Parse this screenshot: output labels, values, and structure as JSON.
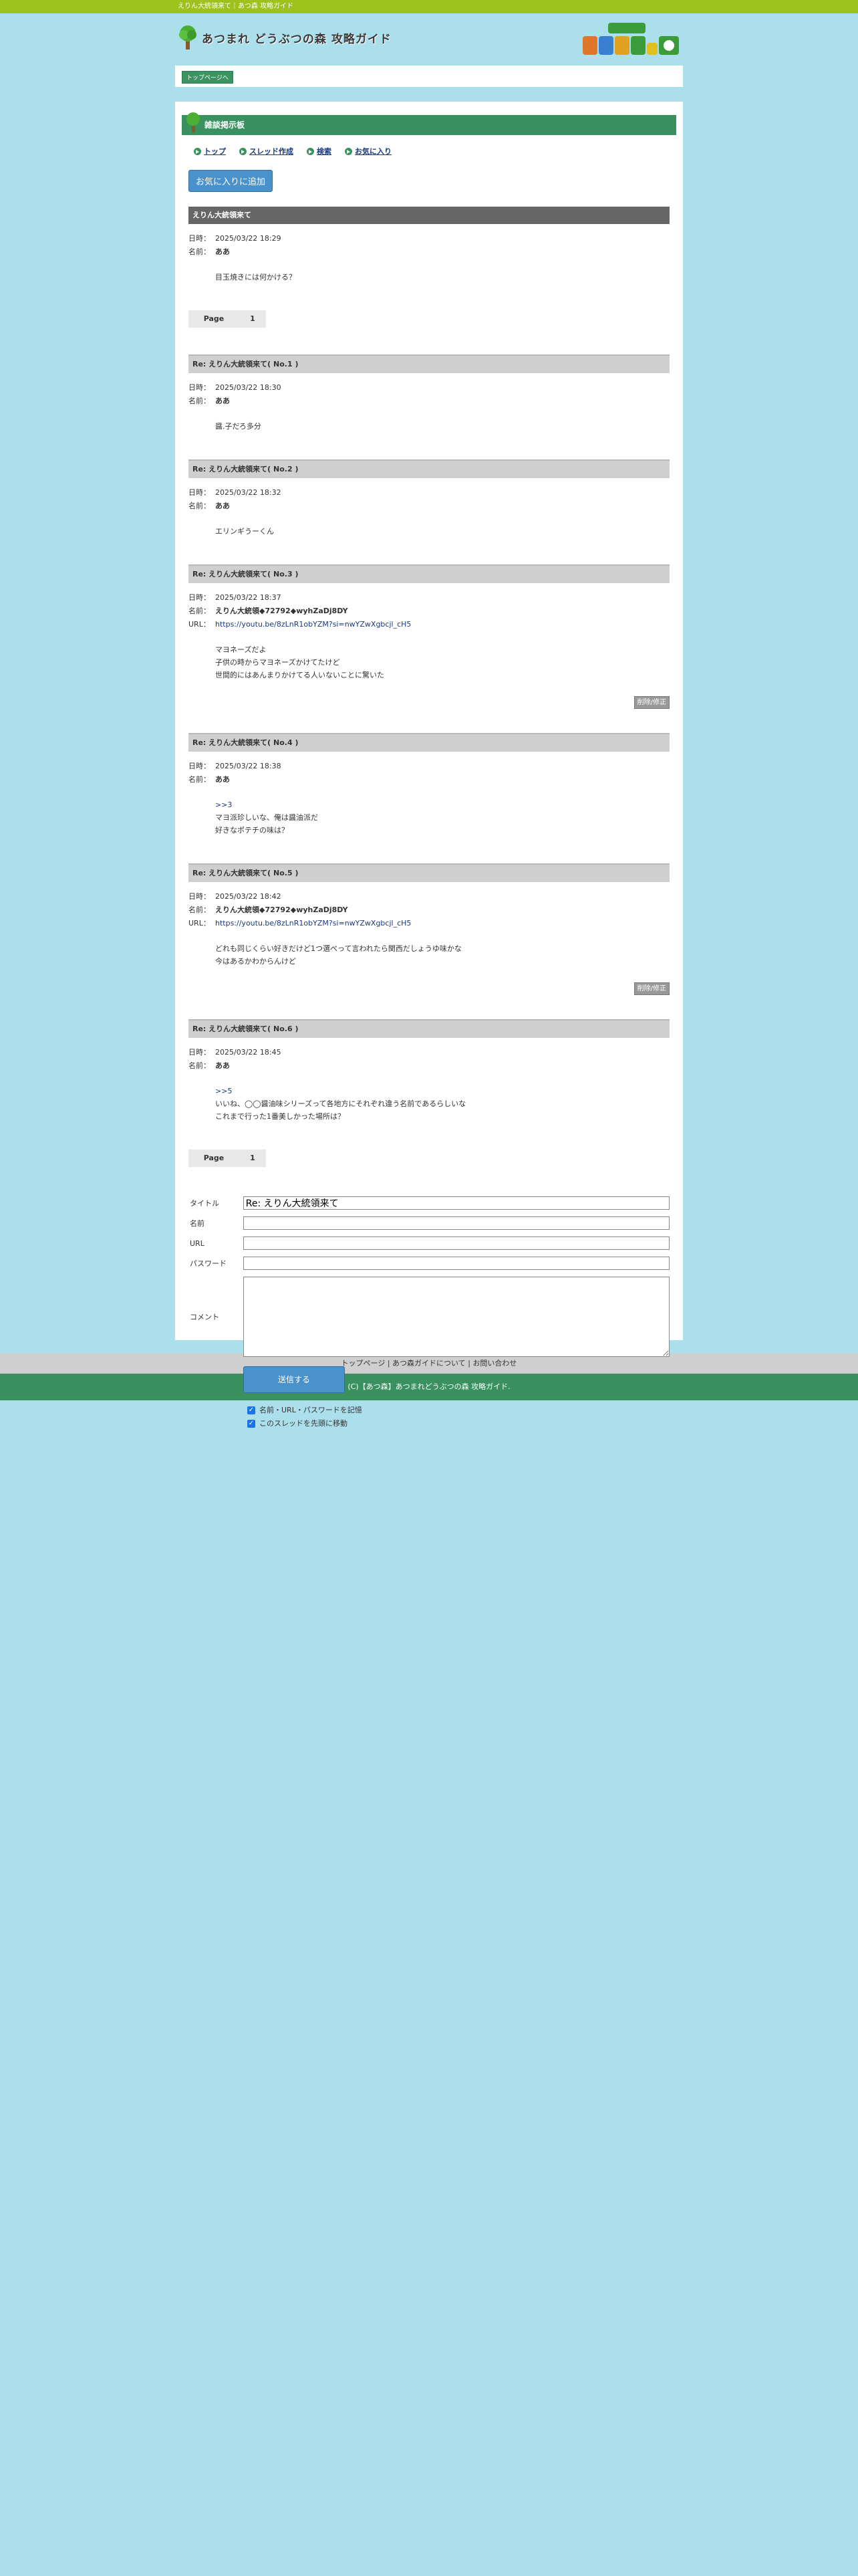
{
  "topbar": {
    "text": "えりん大統領来て｜あつ森 攻略ガイド"
  },
  "header": {
    "title": "あつまれ どうぶつの森 攻略ガイド"
  },
  "breadcrumb": {
    "label": "トップページへ"
  },
  "board": {
    "title": "雑談掲示板"
  },
  "nav": {
    "top": "トップ",
    "new_thread": "スレッド作成",
    "search": "検索",
    "favorites": "お気に入り"
  },
  "fav_button": "お気に入りに追加",
  "thread": {
    "title": "えりん大統領来て",
    "date_label": "日時：",
    "name_label": "名前：",
    "url_label": "URL：",
    "date": "2025/03/22 18:29",
    "name": "ああ",
    "body": "目玉焼きには何かける？"
  },
  "pager_top": {
    "label": "Page",
    "page": "1"
  },
  "posts": [
    {
      "head": "Re: えりん大統領来て( No.1 )",
      "date": "2025/03/22 18:30",
      "name": "ああ",
      "lines": [
        "醤.子だろ多分"
      ]
    },
    {
      "head": "Re: えりん大統領来て( No.2 )",
      "date": "2025/03/22 18:32",
      "name": "ああ",
      "lines": [
        "エリンギうーくん"
      ]
    },
    {
      "head": "Re: えりん大統領来て( No.3 )",
      "date": "2025/03/22 18:37",
      "name": "えりん大統領◆72792◆wyhZaDj8DY",
      "url": "https://youtu.be/8zLnR1obYZM?si=nwYZwXgbcjl_cH5",
      "lines": [
        "マヨネーズだよ",
        "子供の時からマヨネーズかけてたけど",
        "世間的にはあんまりかけてる人いないことに驚いた"
      ],
      "edit": "削除/修正"
    },
    {
      "head": "Re: えりん大統領来て( No.4 )",
      "date": "2025/03/22 18:38",
      "name": "ああ",
      "anchor": ">>3",
      "lines": [
        "マヨ派珍しいな、俺は醤油派だ",
        "好きなポテチの味は？"
      ]
    },
    {
      "head": "Re: えりん大統領来て( No.5 )",
      "date": "2025/03/22 18:42",
      "name": "えりん大統領◆72792◆wyhZaDj8DY",
      "url": "https://youtu.be/8zLnR1obYZM?si=nwYZwXgbcjl_cH5",
      "lines": [
        "どれも同じくらい好きだけど1つ選べって言われたら関西だしょうゆ味かな",
        "今はあるかわからんけど"
      ],
      "edit": "削除/修正"
    },
    {
      "head": "Re: えりん大統領来て( No.6 )",
      "date": "2025/03/22 18:45",
      "name": "ああ",
      "anchor": ">>5",
      "lines": [
        "いいね、◯◯醤油味シリーズって各地方にそれぞれ違う名前であるらしいな",
        "これまで行った1番美しかった場所は？"
      ]
    }
  ],
  "pager_bottom": {
    "label": "Page",
    "page": "1"
  },
  "form": {
    "title_label": "タイトル",
    "title_value": "Re: えりん大統領来て",
    "name_label": "名前",
    "url_label": "URL",
    "password_label": "パスワード",
    "comment_label": "コメント",
    "submit": "送信する",
    "check1": "名前・URL・パスワードを記憶",
    "check2": "このスレッドを先頭に移動"
  },
  "footer": {
    "link1": "トップページ",
    "link2": "あつ森ガイドについて",
    "link3": "お問い合わせ",
    "sep": "|",
    "copyright": "(C)【あつ森】あつまれどうぶつの森 攻略ガイド."
  },
  "colors": {
    "accent_green": "#3a9160",
    "sky": "#acdfec",
    "topbar": "#9dc21c",
    "button_blue": "#4a92cc"
  }
}
